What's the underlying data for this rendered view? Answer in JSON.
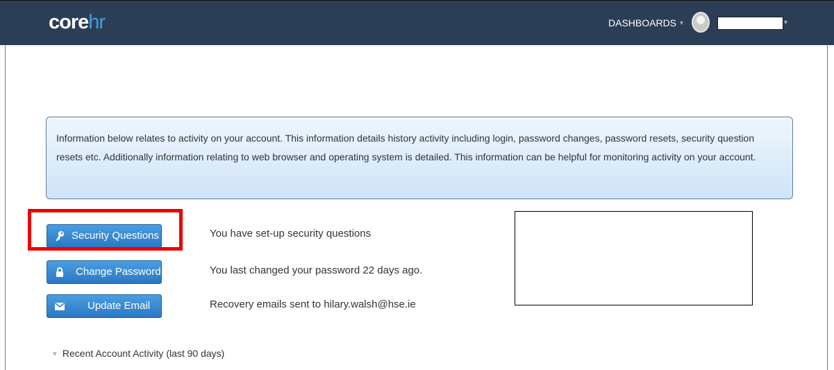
{
  "header": {
    "logo_core": "core",
    "logo_hr": "hr",
    "dashboards_label": "DASHBOARDS",
    "caret": "▼"
  },
  "info_panel": {
    "text": "Information below relates to activity on your account. This information details history activity including login, password changes, password resets, security question resets etc. Additionally information relating to web browser and operating system is detailed. This information can be helpful for monitoring activity on your account."
  },
  "actions": [
    {
      "label": "Security Questions",
      "icon": "key-icon",
      "status": "You have set-up security questions"
    },
    {
      "label": "Change Password",
      "icon": "lock-icon",
      "status": "You last changed your password 22 days ago."
    },
    {
      "label": "Update Email",
      "icon": "envelope-icon",
      "status": "Recovery emails sent to hilary.walsh@hse.ie"
    }
  ],
  "recent_activity": {
    "label": "Recent Account Activity (last 90 days)",
    "toggle": "▼"
  },
  "colors": {
    "topbar": "#2c3e55",
    "accent": "#3ca0df",
    "button": "#2a78c4",
    "highlight": "#ee0000"
  }
}
